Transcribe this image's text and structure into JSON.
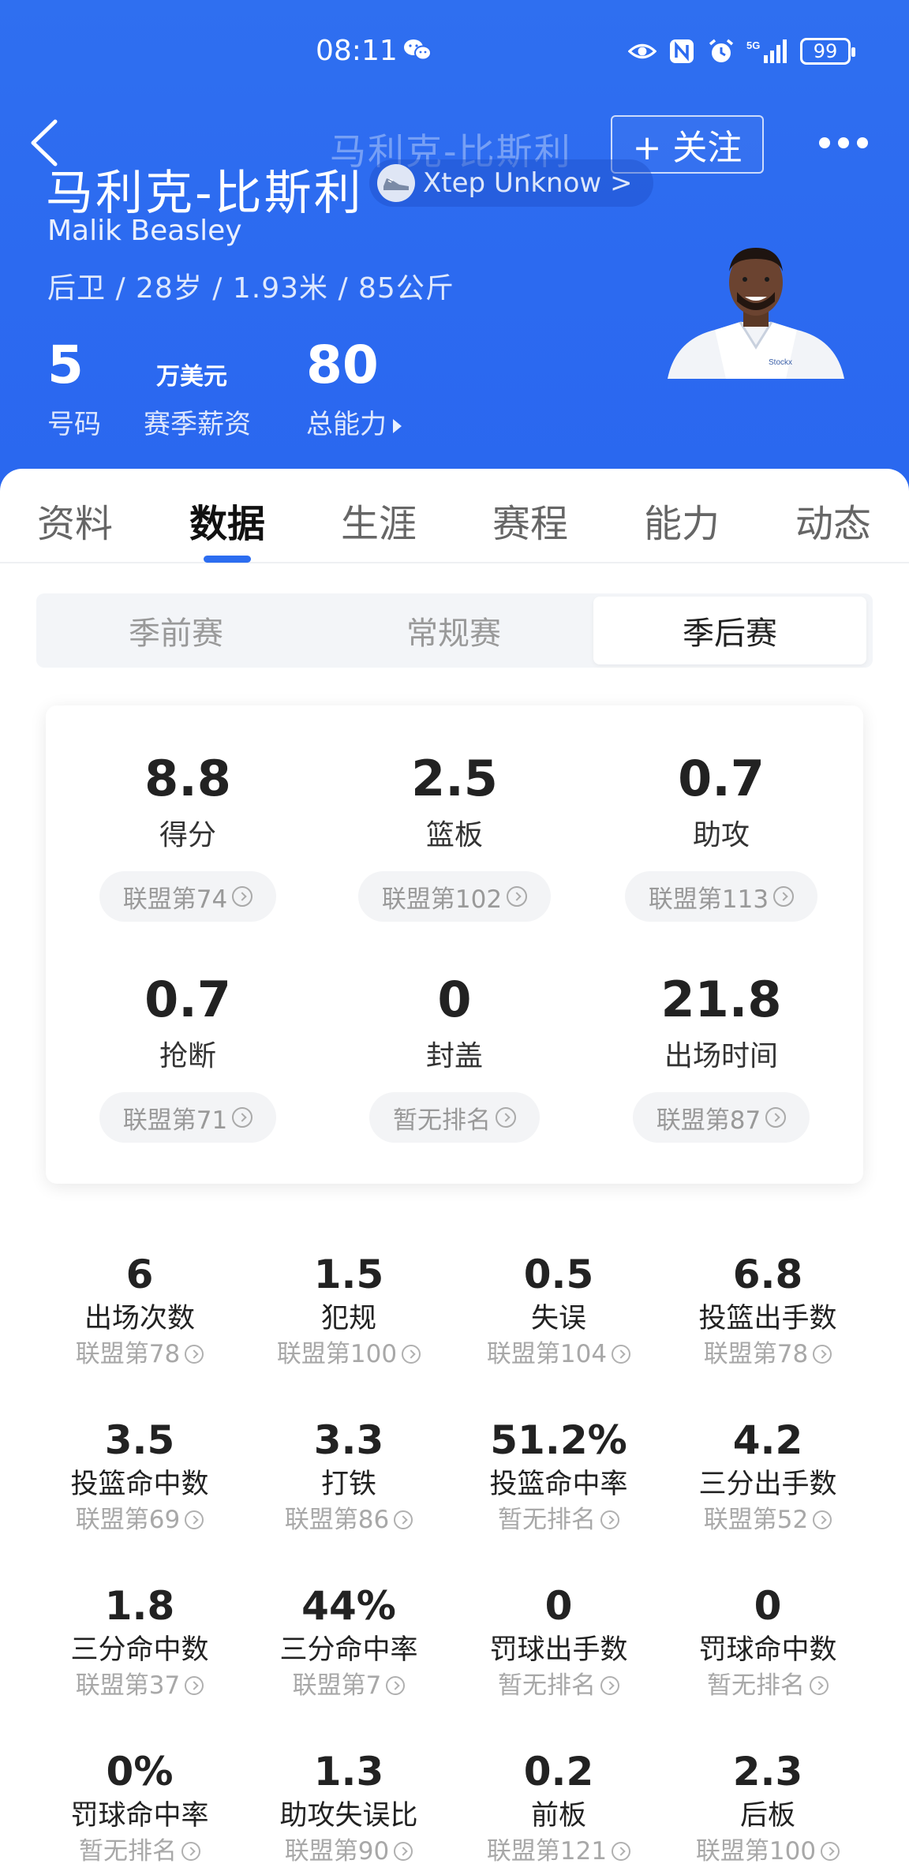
{
  "status_bar": {
    "time": "08:11",
    "battery": "99",
    "icons": [
      "wechat-icon",
      "eye-icon",
      "nfc-icon",
      "alarm-icon",
      "signal-5g-icon"
    ]
  },
  "header": {
    "ghost_title": "马利克-比斯利",
    "follow_label": "+ 关注",
    "player_name": "马利克-比斯利",
    "shoe_label": "Xtep Unknow >",
    "english_name": "Malik Beasley",
    "bio": "后卫 / 28岁 / 1.93米 / 85公斤",
    "number": {
      "value": "5",
      "label": "号码"
    },
    "salary": {
      "value": "万美元",
      "label": "赛季薪资"
    },
    "rating": {
      "value": "80",
      "label": "总能力"
    },
    "colors": {
      "brand_blue": "#2c6af0"
    }
  },
  "tabs": [
    "资料",
    "数据",
    "生涯",
    "赛程",
    "能力",
    "动态"
  ],
  "active_tab": "数据",
  "segments": [
    "季前赛",
    "常规赛",
    "季后赛"
  ],
  "active_segment": "季后赛",
  "main_stats": [
    {
      "value": "8.8",
      "label": "得分",
      "rank": "联盟第74"
    },
    {
      "value": "2.5",
      "label": "篮板",
      "rank": "联盟第102"
    },
    {
      "value": "0.7",
      "label": "助攻",
      "rank": "联盟第113"
    },
    {
      "value": "0.7",
      "label": "抢断",
      "rank": "联盟第71"
    },
    {
      "value": "0",
      "label": "封盖",
      "rank": "暂无排名"
    },
    {
      "value": "21.8",
      "label": "出场时间",
      "rank": "联盟第87"
    }
  ],
  "detail_stats": [
    {
      "value": "6",
      "label": "出场次数",
      "rank": "联盟第78"
    },
    {
      "value": "1.5",
      "label": "犯规",
      "rank": "联盟第100"
    },
    {
      "value": "0.5",
      "label": "失误",
      "rank": "联盟第104"
    },
    {
      "value": "6.8",
      "label": "投篮出手数",
      "rank": "联盟第78"
    },
    {
      "value": "3.5",
      "label": "投篮命中数",
      "rank": "联盟第69"
    },
    {
      "value": "3.3",
      "label": "打铁",
      "rank": "联盟第86"
    },
    {
      "value": "51.2%",
      "label": "投篮命中率",
      "rank": "暂无排名"
    },
    {
      "value": "4.2",
      "label": "三分出手数",
      "rank": "联盟第52"
    },
    {
      "value": "1.8",
      "label": "三分命中数",
      "rank": "联盟第37"
    },
    {
      "value": "44%",
      "label": "三分命中率",
      "rank": "联盟第7"
    },
    {
      "value": "0",
      "label": "罚球出手数",
      "rank": "暂无排名"
    },
    {
      "value": "0",
      "label": "罚球命中数",
      "rank": "暂无排名"
    },
    {
      "value": "0%",
      "label": "罚球命中率",
      "rank": "暂无排名"
    },
    {
      "value": "1.3",
      "label": "助攻失误比",
      "rank": "联盟第90"
    },
    {
      "value": "0.2",
      "label": "前板",
      "rank": "联盟第121"
    },
    {
      "value": "2.3",
      "label": "后板",
      "rank": "联盟第100"
    }
  ],
  "watermark": "联盟第100"
}
